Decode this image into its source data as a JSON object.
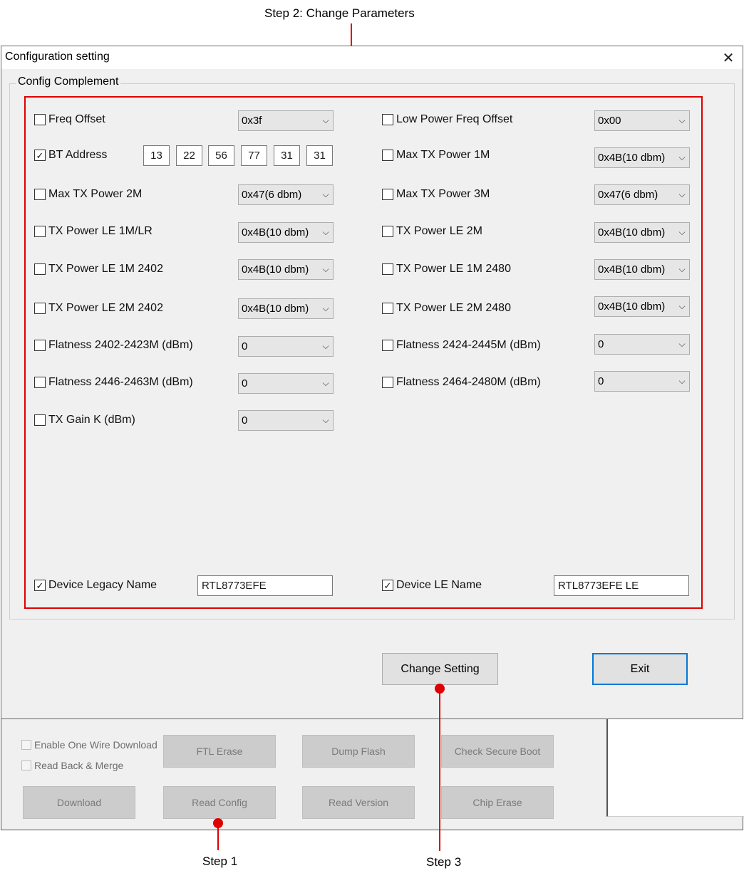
{
  "annotations": {
    "step2": "Step 2: Change Parameters",
    "step1": "Step 1",
    "step3": "Step 3"
  },
  "dialog": {
    "title": "Configuration setting",
    "close_glyph": "✕",
    "group_label": "Config Complement",
    "rows": {
      "freq_offset": {
        "label": "Freq Offset",
        "value": "0x3f",
        "checked": false
      },
      "low_power_freq_offset": {
        "label": "Low Power Freq Offset",
        "value": "0x00",
        "checked": false
      },
      "bt_address": {
        "label": "BT Address",
        "checked": true,
        "bytes": [
          "13",
          "22",
          "56",
          "77",
          "31",
          "31"
        ]
      },
      "max_tx_power_1m": {
        "label": "Max TX Power 1M",
        "value": "0x4B(10 dbm)",
        "checked": false
      },
      "max_tx_power_2m": {
        "label": "Max TX Power 2M",
        "value": "0x47(6 dbm)",
        "checked": false
      },
      "max_tx_power_3m": {
        "label": "Max TX Power 3M",
        "value": "0x47(6 dbm)",
        "checked": false
      },
      "tx_power_le_1m_lr": {
        "label": "TX Power LE 1M/LR",
        "value": "0x4B(10 dbm)",
        "checked": false
      },
      "tx_power_le_2m": {
        "label": "TX Power LE 2M",
        "value": "0x4B(10 dbm)",
        "checked": false
      },
      "tx_power_le_1m_2402": {
        "label": "TX Power LE 1M 2402",
        "value": "0x4B(10 dbm)",
        "checked": false
      },
      "tx_power_le_1m_2480": {
        "label": "TX Power LE 1M 2480",
        "value": "0x4B(10 dbm)",
        "checked": false
      },
      "tx_power_le_2m_2402": {
        "label": "TX Power LE 2M 2402",
        "value": "0x4B(10 dbm)",
        "checked": false
      },
      "tx_power_le_2m_2480": {
        "label": "TX Power LE 2M 2480",
        "value": "0x4B(10 dbm)",
        "checked": false
      },
      "flatness_2402_2423": {
        "label": "Flatness 2402-2423M (dBm)",
        "value": "0",
        "checked": false
      },
      "flatness_2424_2445": {
        "label": "Flatness 2424-2445M (dBm)",
        "value": "0",
        "checked": false
      },
      "flatness_2446_2463": {
        "label": "Flatness 2446-2463M (dBm)",
        "value": "0",
        "checked": false
      },
      "flatness_2464_2480": {
        "label": "Flatness 2464-2480M (dBm)",
        "value": "0",
        "checked": false
      },
      "tx_gain_k": {
        "label": "TX Gain K (dBm)",
        "value": "0",
        "checked": false
      },
      "device_legacy_name": {
        "label": "Device Legacy Name",
        "value": "RTL8773EFE",
        "checked": true
      },
      "device_le_name": {
        "label": "Device LE Name",
        "value": "RTL8773EFE LE",
        "checked": true
      }
    },
    "buttons": {
      "change_setting": "Change Setting",
      "exit": "Exit"
    }
  },
  "background_app": {
    "enable_one_wire": "Enable One Wire Download",
    "read_back_merge": "Read Back & Merge",
    "buttons": {
      "ftl_erase": "FTL Erase",
      "dump_flash": "Dump Flash",
      "check_secure_boot": "Check Secure Boot",
      "download": "Download",
      "read_config": "Read Config",
      "read_version": "Read Version",
      "chip_erase": "Chip Erase"
    }
  },
  "icons": {
    "checkbox_checked": "✓",
    "chevron": "⌵"
  },
  "colors": {
    "annotation_red": "#e00000",
    "default_button_border": "#0078d7"
  }
}
